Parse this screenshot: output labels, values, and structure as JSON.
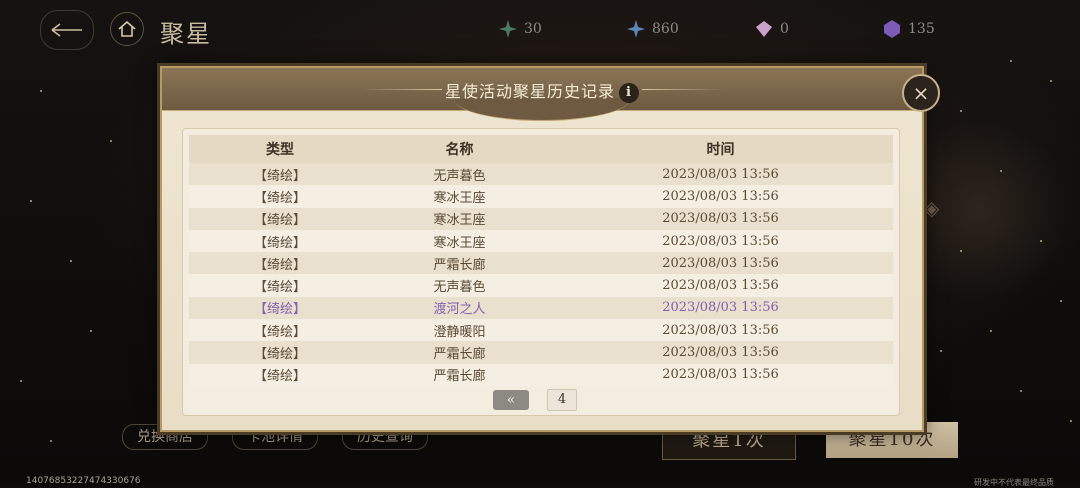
{
  "topbar": {
    "title": "聚星",
    "resources": [
      {
        "icon": "star-shard-icon",
        "value": "30",
        "color": "#4d7a66"
      },
      {
        "icon": "star-crystal-icon",
        "value": "860",
        "color": "#5a86b8"
      },
      {
        "icon": "prism-gem-icon",
        "value": "0",
        "color": "#c9a0c8"
      },
      {
        "icon": "purple-gem-icon",
        "value": "135",
        "color": "#7b5ab8"
      }
    ]
  },
  "modal": {
    "title": "星使活动聚星历史记录",
    "info_icon": "i",
    "close_icon": "×",
    "columns": {
      "type": "类型",
      "name": "名称",
      "time": "时间"
    },
    "rows": [
      {
        "type": "【绮绘】",
        "name": "无声暮色",
        "time": "2023/08/03 13:56"
      },
      {
        "type": "【绮绘】",
        "name": "寒冰王座",
        "time": "2023/08/03 13:56"
      },
      {
        "type": "【绮绘】",
        "name": "寒冰王座",
        "time": "2023/08/03 13:56"
      },
      {
        "type": "【绮绘】",
        "name": "寒冰王座",
        "time": "2023/08/03 13:56"
      },
      {
        "type": "【绮绘】",
        "name": "严霜长廊",
        "time": "2023/08/03 13:56"
      },
      {
        "type": "【绮绘】",
        "name": "无声暮色",
        "time": "2023/08/03 13:56"
      },
      {
        "type": "【绮绘】",
        "name": "渡河之人",
        "time": "2023/08/03 13:56",
        "highlight": "purple"
      },
      {
        "type": "【绮绘】",
        "name": "澄静暖阳",
        "time": "2023/08/03 13:56"
      },
      {
        "type": "【绮绘】",
        "name": "严霜长廊",
        "time": "2023/08/03 13:56"
      },
      {
        "type": "【绮绘】",
        "name": "严霜长廊",
        "time": "2023/08/03 13:56"
      }
    ],
    "pager": {
      "prev_label": "«",
      "page": "4"
    }
  },
  "bottom": {
    "exchange_shop": "兑换商店",
    "pool_details": "卡池详情",
    "history_query": "历史查询",
    "summon_1": "聚星1次",
    "summon_10": "聚星10次"
  },
  "footer": {
    "uid": "14076853227474330676",
    "disclaimer": "研发中不代表最终品质"
  },
  "colors": {
    "accent_purple": "#8660b2",
    "header_brown": "#6d5a40",
    "panel_cream": "#f3ede0"
  }
}
